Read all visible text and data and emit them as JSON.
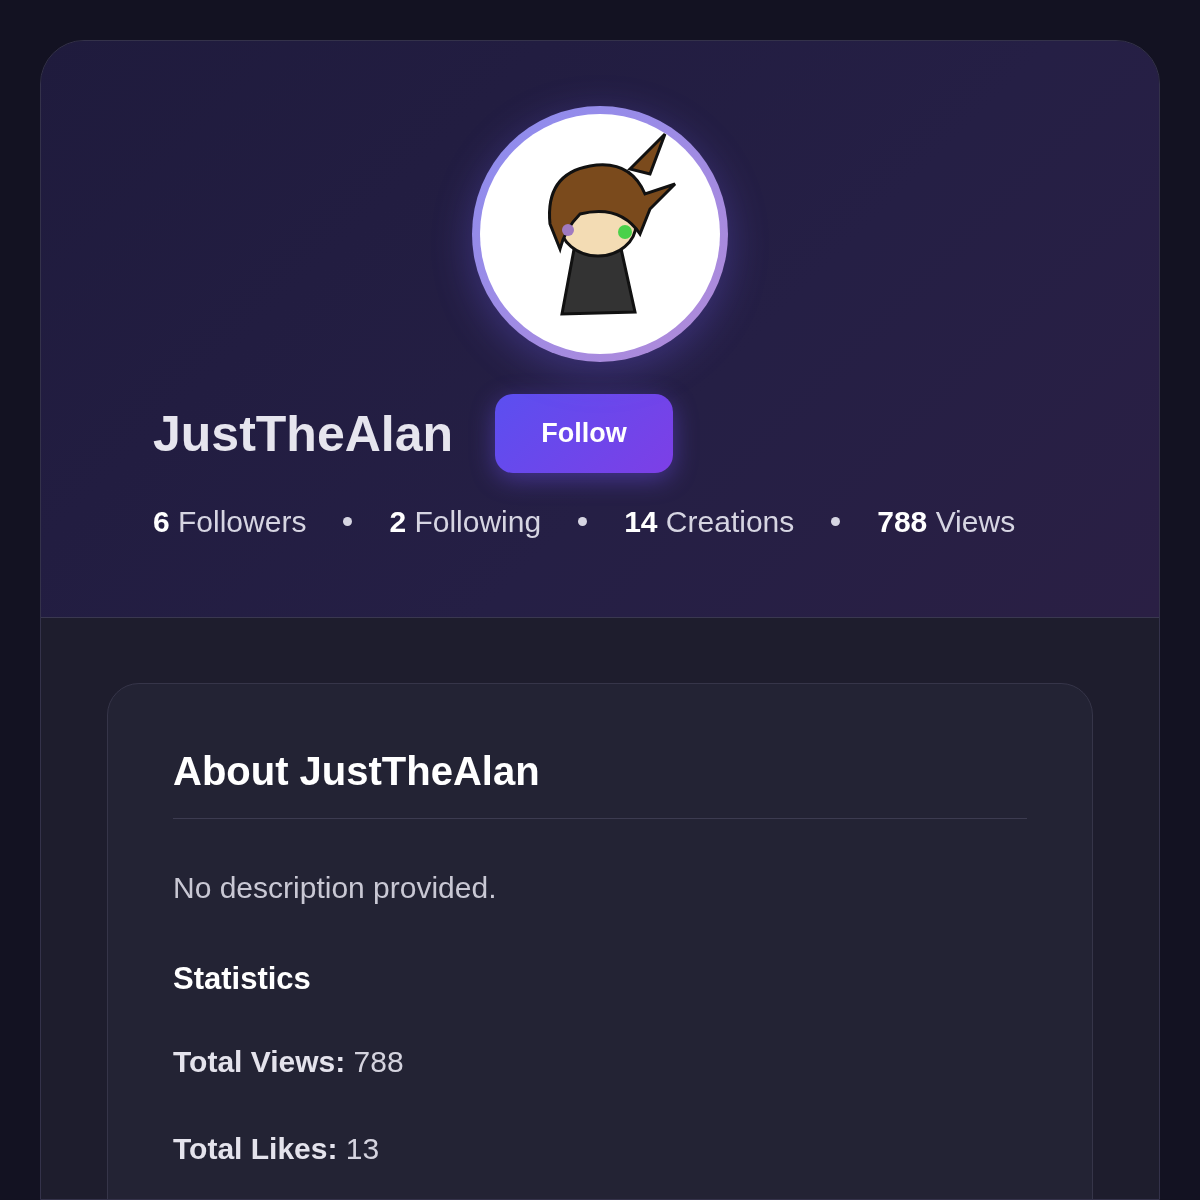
{
  "profile": {
    "username": "JustTheAlan",
    "follow_button": "Follow",
    "stats": [
      {
        "text": "**6** Followers"
      },
      {
        "text": "**2** Following"
      },
      {
        "text": "**14** Creations"
      },
      {
        "text": "**788** Views"
      }
    ]
  },
  "about": {
    "title": "About JustTheAlan",
    "description": "No description provided.",
    "statistics_heading": "Statistics",
    "statistics": [
      {
        "text": "**Total Views:** 788"
      },
      {
        "text": "**Total Likes:** 13"
      }
    ]
  }
}
